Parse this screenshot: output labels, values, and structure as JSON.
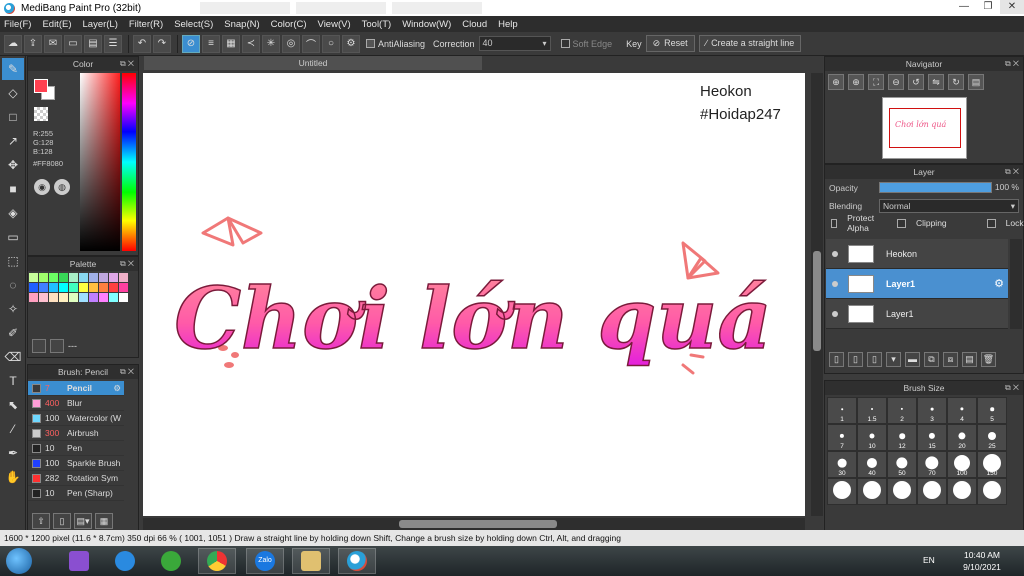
{
  "window": {
    "title": "MediBang Paint Pro (32bit)"
  },
  "menu": [
    "File(F)",
    "Edit(E)",
    "Layer(L)",
    "Filter(R)",
    "Select(S)",
    "Snap(N)",
    "Color(C)",
    "View(V)",
    "Tool(T)",
    "Window(W)",
    "Cloud",
    "Help"
  ],
  "toolbar": {
    "antialiasing_label": "AntiAliasing",
    "correction_label": "Correction",
    "correction_value": "40",
    "soft_edge_label": "Soft Edge",
    "key_label": "Key",
    "reset_label": "Reset",
    "straight_line_label": "Create a straight line"
  },
  "color_panel": {
    "title": "Color",
    "r": "R:255",
    "g": "G:128",
    "b": "B:128",
    "hex": "#FF8080",
    "fg_color": "#ff4050"
  },
  "palette_panel": {
    "title": "Palette",
    "footer_text": "---",
    "colors": [
      "#c8ff9c",
      "#a0ff6c",
      "#6cff64",
      "#38d858",
      "#a8f0c8",
      "#88d8f0",
      "#a0b0e8",
      "#c0a8e0",
      "#e0a8e8",
      "#f0b0c8",
      "#2060ff",
      "#4080ff",
      "#20c0ff",
      "#00ffff",
      "#40ffc0",
      "#ffff40",
      "#ffc040",
      "#ff8040",
      "#ff4040",
      "#ff40a0",
      "#ffa0c0",
      "#ffc0d0",
      "#ffe0c0",
      "#fff0c0",
      "#e0ffc0",
      "#a0e0ff",
      "#c080ff",
      "#ff80ff",
      "#80ffff",
      "#ffffff"
    ]
  },
  "brush_panel": {
    "title": "Brush: Pencil",
    "brushes": [
      {
        "size": "7",
        "name": "Pencil",
        "color": "#3a3a3a"
      },
      {
        "size": "400",
        "name": "Blur",
        "color": "#ff9ed8"
      },
      {
        "size": "100",
        "name": "Watercolor (W",
        "color": "#6fd8ff"
      },
      {
        "size": "300",
        "name": "Airbrush",
        "color": "#cccccc"
      },
      {
        "size": "10",
        "name": "Pen",
        "color": "#222222"
      },
      {
        "size": "100",
        "name": "Sparkle Brush",
        "color": "#2040ff"
      },
      {
        "size": "282",
        "name": "Rotation Sym",
        "color": "#ff3030"
      },
      {
        "size": "10",
        "name": "Pen (Sharp)",
        "color": "#222222"
      }
    ]
  },
  "canvas": {
    "tab": "Untitled",
    "watermark_line1": "Heokon",
    "watermark_line2": "#Hoidap247",
    "art_text": "Chơi lớn quá"
  },
  "navigator": {
    "title": "Navigator"
  },
  "layer_panel": {
    "title": "Layer",
    "opacity_label": "Opacity",
    "opacity_value": "100 %",
    "opacity_fraction": 1.0,
    "blending_label": "Blending",
    "blending_value": "Normal",
    "protect_alpha": "Protect Alpha",
    "clipping": "Clipping",
    "lock": "Lock",
    "layers": [
      {
        "name": "Heokon",
        "selected": false
      },
      {
        "name": "Layer1",
        "selected": true
      },
      {
        "name": "Layer1",
        "selected": false
      }
    ]
  },
  "brush_size_panel": {
    "title": "Brush Size",
    "sizes": [
      "1",
      "1.5",
      "2",
      "3",
      "4",
      "5",
      "7",
      "10",
      "12",
      "15",
      "20",
      "25",
      "30",
      "40",
      "50",
      "70",
      "100",
      "150",
      "",
      "",
      "",
      "",
      "",
      ""
    ]
  },
  "status_bar": {
    "text": "1600 * 1200 pixel  (11.6 * 8.7cm)  350 dpi  66 %   ( 1001, 1051 )   Draw a straight line by holding down Shift, Change a brush size by holding down Ctrl, Alt, and dragging"
  },
  "taskbar": {
    "lang": "EN",
    "time": "10:40 AM",
    "date": "9/10/2021",
    "zalo_label": "Zalo"
  }
}
